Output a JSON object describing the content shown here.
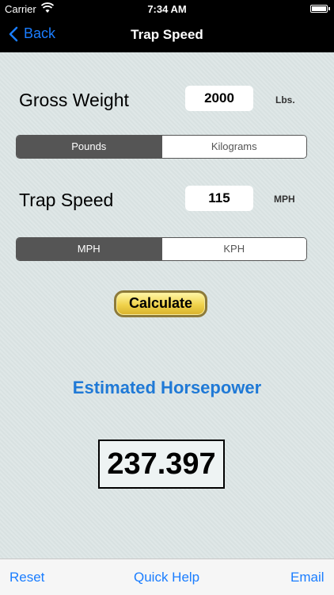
{
  "status_bar": {
    "carrier": "Carrier",
    "time": "7:34 AM",
    "wifi_icon": "wifi-icon",
    "battery_icon": "battery-icon",
    "battery_level": 1.0
  },
  "nav": {
    "back_label": "Back",
    "title": "Trap Speed"
  },
  "weight": {
    "label": "Gross Weight",
    "value": "2000",
    "unit": "Lbs."
  },
  "weight_units": {
    "options": [
      "Pounds",
      "Kilograms"
    ],
    "selected": "Pounds"
  },
  "speed": {
    "label": "Trap Speed",
    "value": "115",
    "unit": "MPH"
  },
  "speed_units": {
    "options": [
      "MPH",
      "KPH"
    ],
    "selected": "MPH"
  },
  "calculate_label": "Calculate",
  "result": {
    "title": "Estimated Horsepower",
    "value": "237.397"
  },
  "toolbar": {
    "reset": "Reset",
    "quick_help": "Quick Help",
    "email": "Email"
  },
  "colors": {
    "accent": "#1a7dff",
    "result_title": "#1f79d6",
    "calculate_fill": "#f0d24a",
    "segment_selected": "#555555"
  }
}
